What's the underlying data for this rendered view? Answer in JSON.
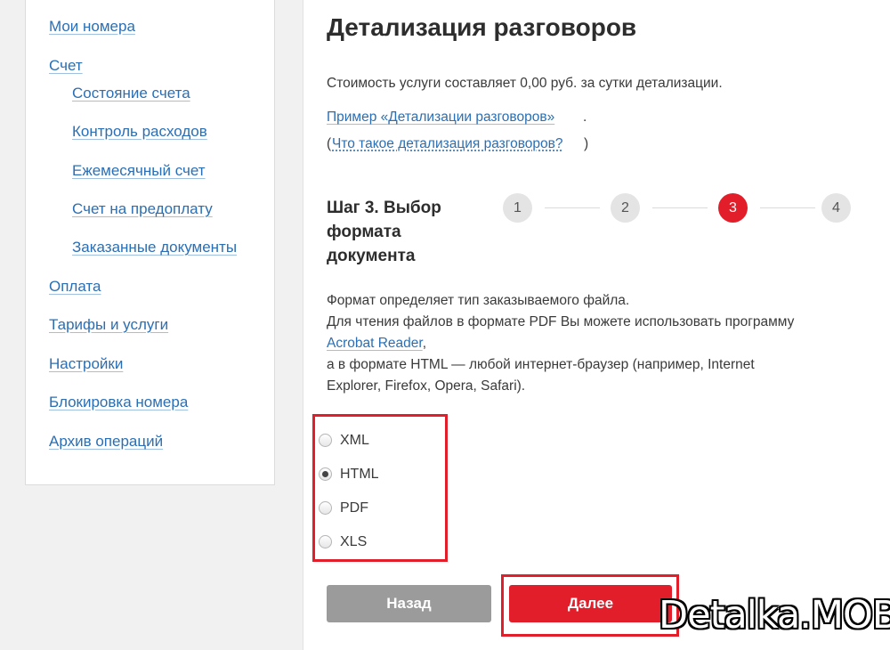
{
  "sidebar": {
    "items": [
      {
        "label": "Мои номера"
      },
      {
        "label": "Счет"
      },
      {
        "label": "Состояние счета"
      },
      {
        "label": "Контроль расходов"
      },
      {
        "label": "Ежемесячный счет"
      },
      {
        "label": "Счет на предоплату"
      },
      {
        "label": "Заказанные документы"
      },
      {
        "label": "Оплата"
      },
      {
        "label": "Тарифы и услуги"
      },
      {
        "label": "Настройки"
      },
      {
        "label": "Блокировка номера"
      },
      {
        "label": "Архив операций"
      }
    ]
  },
  "main": {
    "title": "Детализация разговоров",
    "cost_text": "Стоимость услуги составляет 0,00 руб. за сутки детализации.",
    "example_link": "Пример «Детализации разговоров»",
    "example_suffix": ".",
    "what_is_open": "(",
    "what_is_link": "Что такое детализация разговоров?",
    "what_is_close": ")",
    "step": {
      "title": "Шаг 3. Выбор формата документа",
      "steps": [
        "1",
        "2",
        "3",
        "4"
      ],
      "active": 3
    },
    "description": {
      "line1": "Формат определяет тип заказываемого файла.",
      "line2": "Для чтения файлов в формате PDF Вы можете использовать программу",
      "reader_link": "Acrobat Reader",
      "line3_suffix": ",",
      "line4": "а в формате HTML — любой интернет-браузер (например, Internet",
      "line5": "Explorer, Firefox, Opera, Safari)."
    },
    "formats": [
      {
        "label": "XML",
        "checked": false
      },
      {
        "label": "HTML",
        "checked": true
      },
      {
        "label": "PDF",
        "checked": false
      },
      {
        "label": "XLS",
        "checked": false
      }
    ],
    "buttons": {
      "back": "Назад",
      "next": "Далее"
    },
    "highlight_color": "#e21e2b"
  },
  "watermark": "Detalka.MOBI"
}
